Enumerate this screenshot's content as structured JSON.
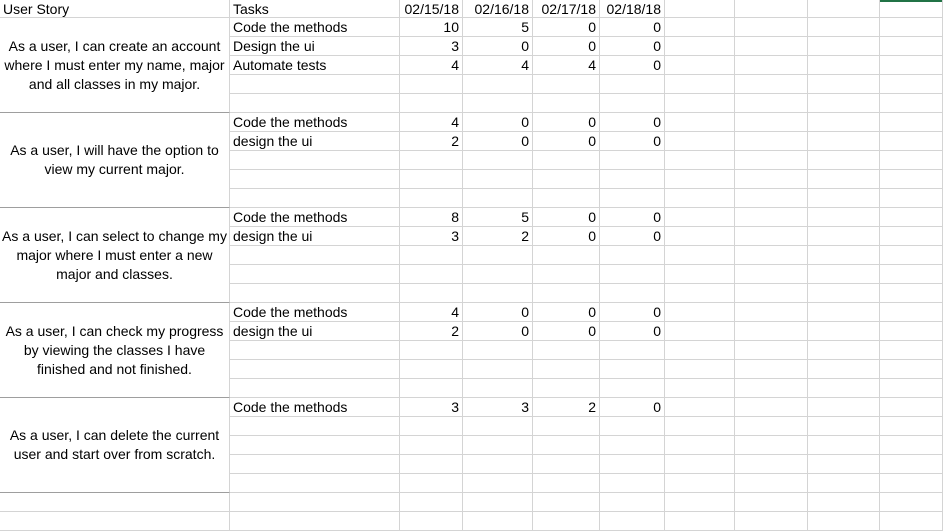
{
  "headers": {
    "user_story": "User Story",
    "tasks": "Tasks",
    "dates": [
      "02/15/18",
      "02/16/18",
      "02/17/18",
      "02/18/18"
    ]
  },
  "stories": [
    {
      "text": "As a user, I can create an account where I must enter my name, major and all classes in my major.",
      "tasks": [
        {
          "name": "Code the methods",
          "values": [
            "10",
            "5",
            "0",
            "0"
          ]
        },
        {
          "name": "Design the ui",
          "values": [
            "3",
            "0",
            "0",
            "0"
          ]
        },
        {
          "name": "Automate tests",
          "values": [
            "4",
            "4",
            "4",
            "0"
          ]
        }
      ]
    },
    {
      "text": "As a user, I will have the option to view my current major.",
      "tasks": [
        {
          "name": "Code the methods",
          "values": [
            "4",
            "0",
            "0",
            "0"
          ]
        },
        {
          "name": "design the ui",
          "values": [
            "2",
            "0",
            "0",
            "0"
          ]
        }
      ]
    },
    {
      "text": "As a user, I can select to change my major where I must enter a new major and classes.",
      "tasks": [
        {
          "name": "Code the methods",
          "values": [
            "8",
            "5",
            "0",
            "0"
          ]
        },
        {
          "name": "design the ui",
          "values": [
            "3",
            "2",
            "0",
            "0"
          ]
        }
      ]
    },
    {
      "text": "As a user, I can check my progress by viewing the classes I have finished and not finished.",
      "tasks": [
        {
          "name": "Code the methods",
          "values": [
            "4",
            "0",
            "0",
            "0"
          ]
        },
        {
          "name": "design the ui",
          "values": [
            "2",
            "0",
            "0",
            "0"
          ]
        }
      ]
    },
    {
      "text": "As a user, I can delete the current user and start over from scratch.",
      "tasks": [
        {
          "name": "Code the methods",
          "values": [
            "3",
            "3",
            "2",
            "0"
          ]
        }
      ]
    }
  ]
}
